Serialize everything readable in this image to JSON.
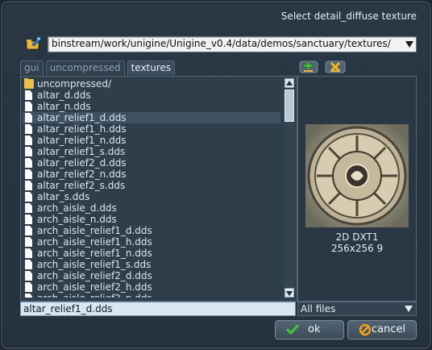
{
  "dialog": {
    "title": "Select detail_diffuse texture",
    "path": "binstream/work/unigine/Unigine_v0.4/data/demos/sanctuary/textures/"
  },
  "tabs": [
    {
      "label": "gui",
      "active": false
    },
    {
      "label": "uncompressed",
      "active": false
    },
    {
      "label": "textures",
      "active": true
    }
  ],
  "file_list": {
    "items": [
      {
        "name": "uncompressed/",
        "type": "folder"
      },
      {
        "name": "altar_d.dds",
        "type": "file"
      },
      {
        "name": "altar_n.dds",
        "type": "file"
      },
      {
        "name": "altar_relief1_d.dds",
        "type": "file",
        "selected": true
      },
      {
        "name": "altar_relief1_h.dds",
        "type": "file"
      },
      {
        "name": "altar_relief1_n.dds",
        "type": "file"
      },
      {
        "name": "altar_relief1_s.dds",
        "type": "file"
      },
      {
        "name": "altar_relief2_d.dds",
        "type": "file"
      },
      {
        "name": "altar_relief2_n.dds",
        "type": "file"
      },
      {
        "name": "altar_relief2_s.dds",
        "type": "file"
      },
      {
        "name": "altar_s.dds",
        "type": "file"
      },
      {
        "name": "arch_aisle_d.dds",
        "type": "file"
      },
      {
        "name": "arch_aisle_n.dds",
        "type": "file"
      },
      {
        "name": "arch_aisle_relief1_d.dds",
        "type": "file"
      },
      {
        "name": "arch_aisle_relief1_h.dds",
        "type": "file"
      },
      {
        "name": "arch_aisle_relief1_n.dds",
        "type": "file"
      },
      {
        "name": "arch_aisle_relief1_s.dds",
        "type": "file"
      },
      {
        "name": "arch_aisle_relief2_d.dds",
        "type": "file"
      },
      {
        "name": "arch_aisle_relief2_h.dds",
        "type": "file"
      },
      {
        "name": "arch_aisle_relief2_n.dds",
        "type": "file"
      }
    ]
  },
  "preview": {
    "format": "2D DXT1",
    "dimensions": "256x256 9"
  },
  "filename_input": "altar_relief1_d.dds",
  "filter": {
    "selected": "All files"
  },
  "buttons": {
    "ok": "ok",
    "cancel": "cancel"
  },
  "colors": {
    "accent": "#3f5261",
    "check": "#44c23a",
    "cancel_icon": "#f0a21a"
  }
}
